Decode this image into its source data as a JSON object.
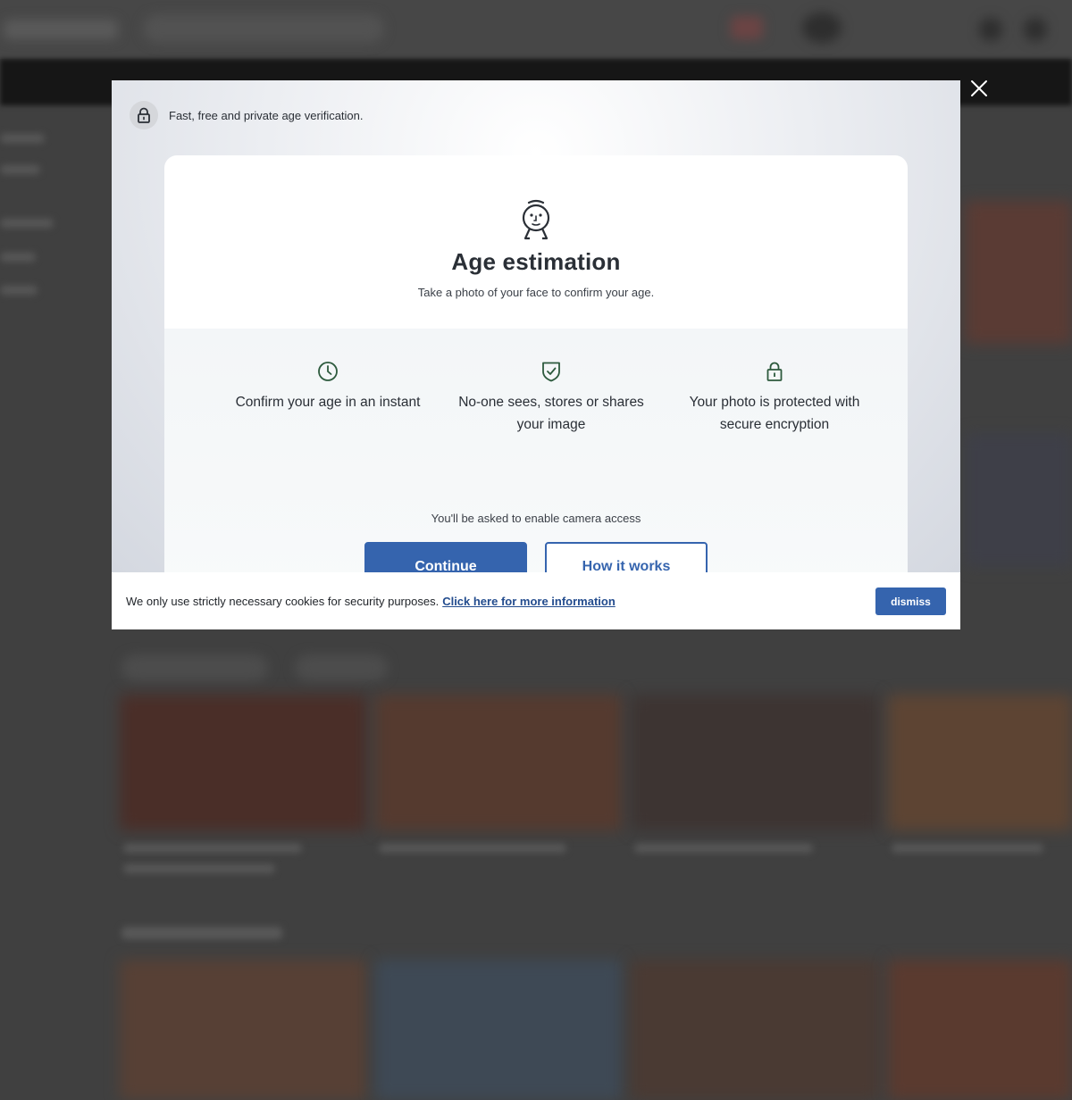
{
  "modal": {
    "close_icon": "close-icon",
    "privacy_text": "Fast, free and private age verification.",
    "privacy_icon": "lock-icon",
    "card": {
      "icon": "face-icon",
      "title": "Age estimation",
      "subtitle": "Take a photo of your face to confirm your age.",
      "features": [
        {
          "icon": "clock-icon",
          "label": "Confirm your age in an instant"
        },
        {
          "icon": "shield-check-icon",
          "label": "No-one sees, stores or shares your image"
        },
        {
          "icon": "lock-icon",
          "label": "Your photo is protected with secure encryption"
        }
      ],
      "camera_note": "You'll be asked to enable camera access",
      "continue_label": "Continue",
      "how_it_works_label": "How it works"
    }
  },
  "cookie_bar": {
    "text": "We only use strictly necessary cookies for security purposes.",
    "link_text": "Click here for more information",
    "dismiss_label": "dismiss"
  },
  "colors": {
    "accent": "#3564ae",
    "icon_green": "#2d5a3d",
    "text_dark": "#2a2f36"
  }
}
